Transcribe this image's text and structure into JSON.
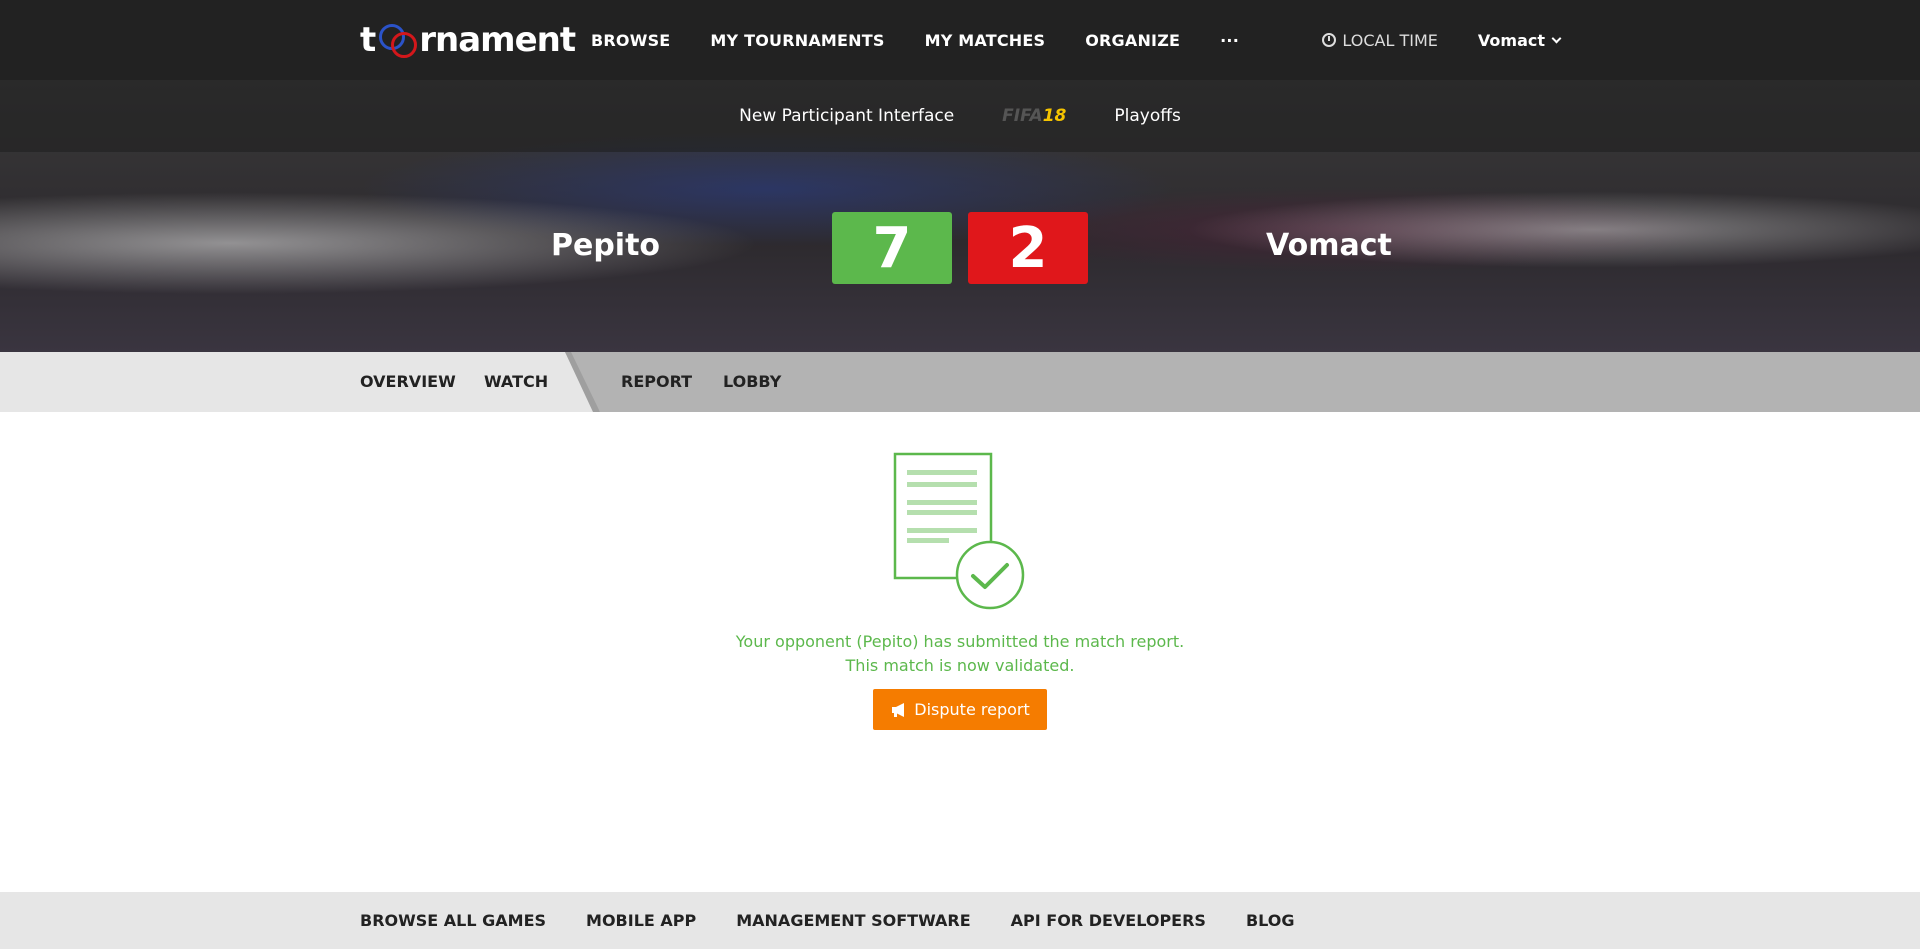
{
  "brand": {
    "logo_prefix": "t",
    "logo_suffix": "rnament"
  },
  "nav": {
    "items": [
      "BROWSE",
      "MY TOURNAMENTS",
      "MY MATCHES",
      "ORGANIZE",
      "···"
    ],
    "local_time": "LOCAL TIME",
    "user": "Vomact"
  },
  "subnav": {
    "tournament": "New Participant Interface",
    "game_prefix": "FIFA",
    "game_suffix": "18",
    "stage": "Playoffs"
  },
  "match": {
    "left_team": "Pepito",
    "right_team": "Vomact",
    "left_score": "7",
    "right_score": "2",
    "colors": {
      "win": "#5cb84c",
      "loss": "#e0171b"
    }
  },
  "tabs": [
    "OVERVIEW",
    "WATCH",
    "REPORT",
    "LOBBY"
  ],
  "report": {
    "line1": "Your opponent (Pepito) has submitted the match report.",
    "line2": "This match is now validated.",
    "button": "Dispute report",
    "accent": "#f57c00"
  },
  "footer": {
    "links": [
      "BROWSE ALL GAMES",
      "MOBILE APP",
      "MANAGEMENT SOFTWARE",
      "API FOR DEVELOPERS",
      "BLOG"
    ]
  }
}
